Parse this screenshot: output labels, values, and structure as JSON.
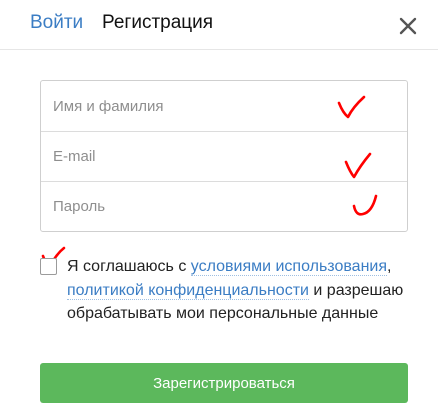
{
  "header": {
    "tabs": [
      {
        "label": "Войти",
        "active": false
      },
      {
        "label": "Регистрация",
        "active": true
      }
    ],
    "close_icon": "close-icon"
  },
  "form": {
    "name_placeholder": "Имя и фамилия",
    "email_placeholder": "E-mail",
    "password_placeholder": "Пароль",
    "name_value": "",
    "email_value": "",
    "password_value": ""
  },
  "consent": {
    "checked": false,
    "text_before": "Я соглашаюсь с ",
    "terms_link": "условиями использования",
    "comma": ",",
    "privacy_link": "политикой конфиденциальности",
    "text_after": " и разрешаю обрабатывать мои персональные данные"
  },
  "submit_label": "Зарегистрироваться",
  "colors": {
    "accent_link": "#3b7dc4",
    "button_green": "#5cb85c",
    "annotation_red": "#ff0000"
  }
}
